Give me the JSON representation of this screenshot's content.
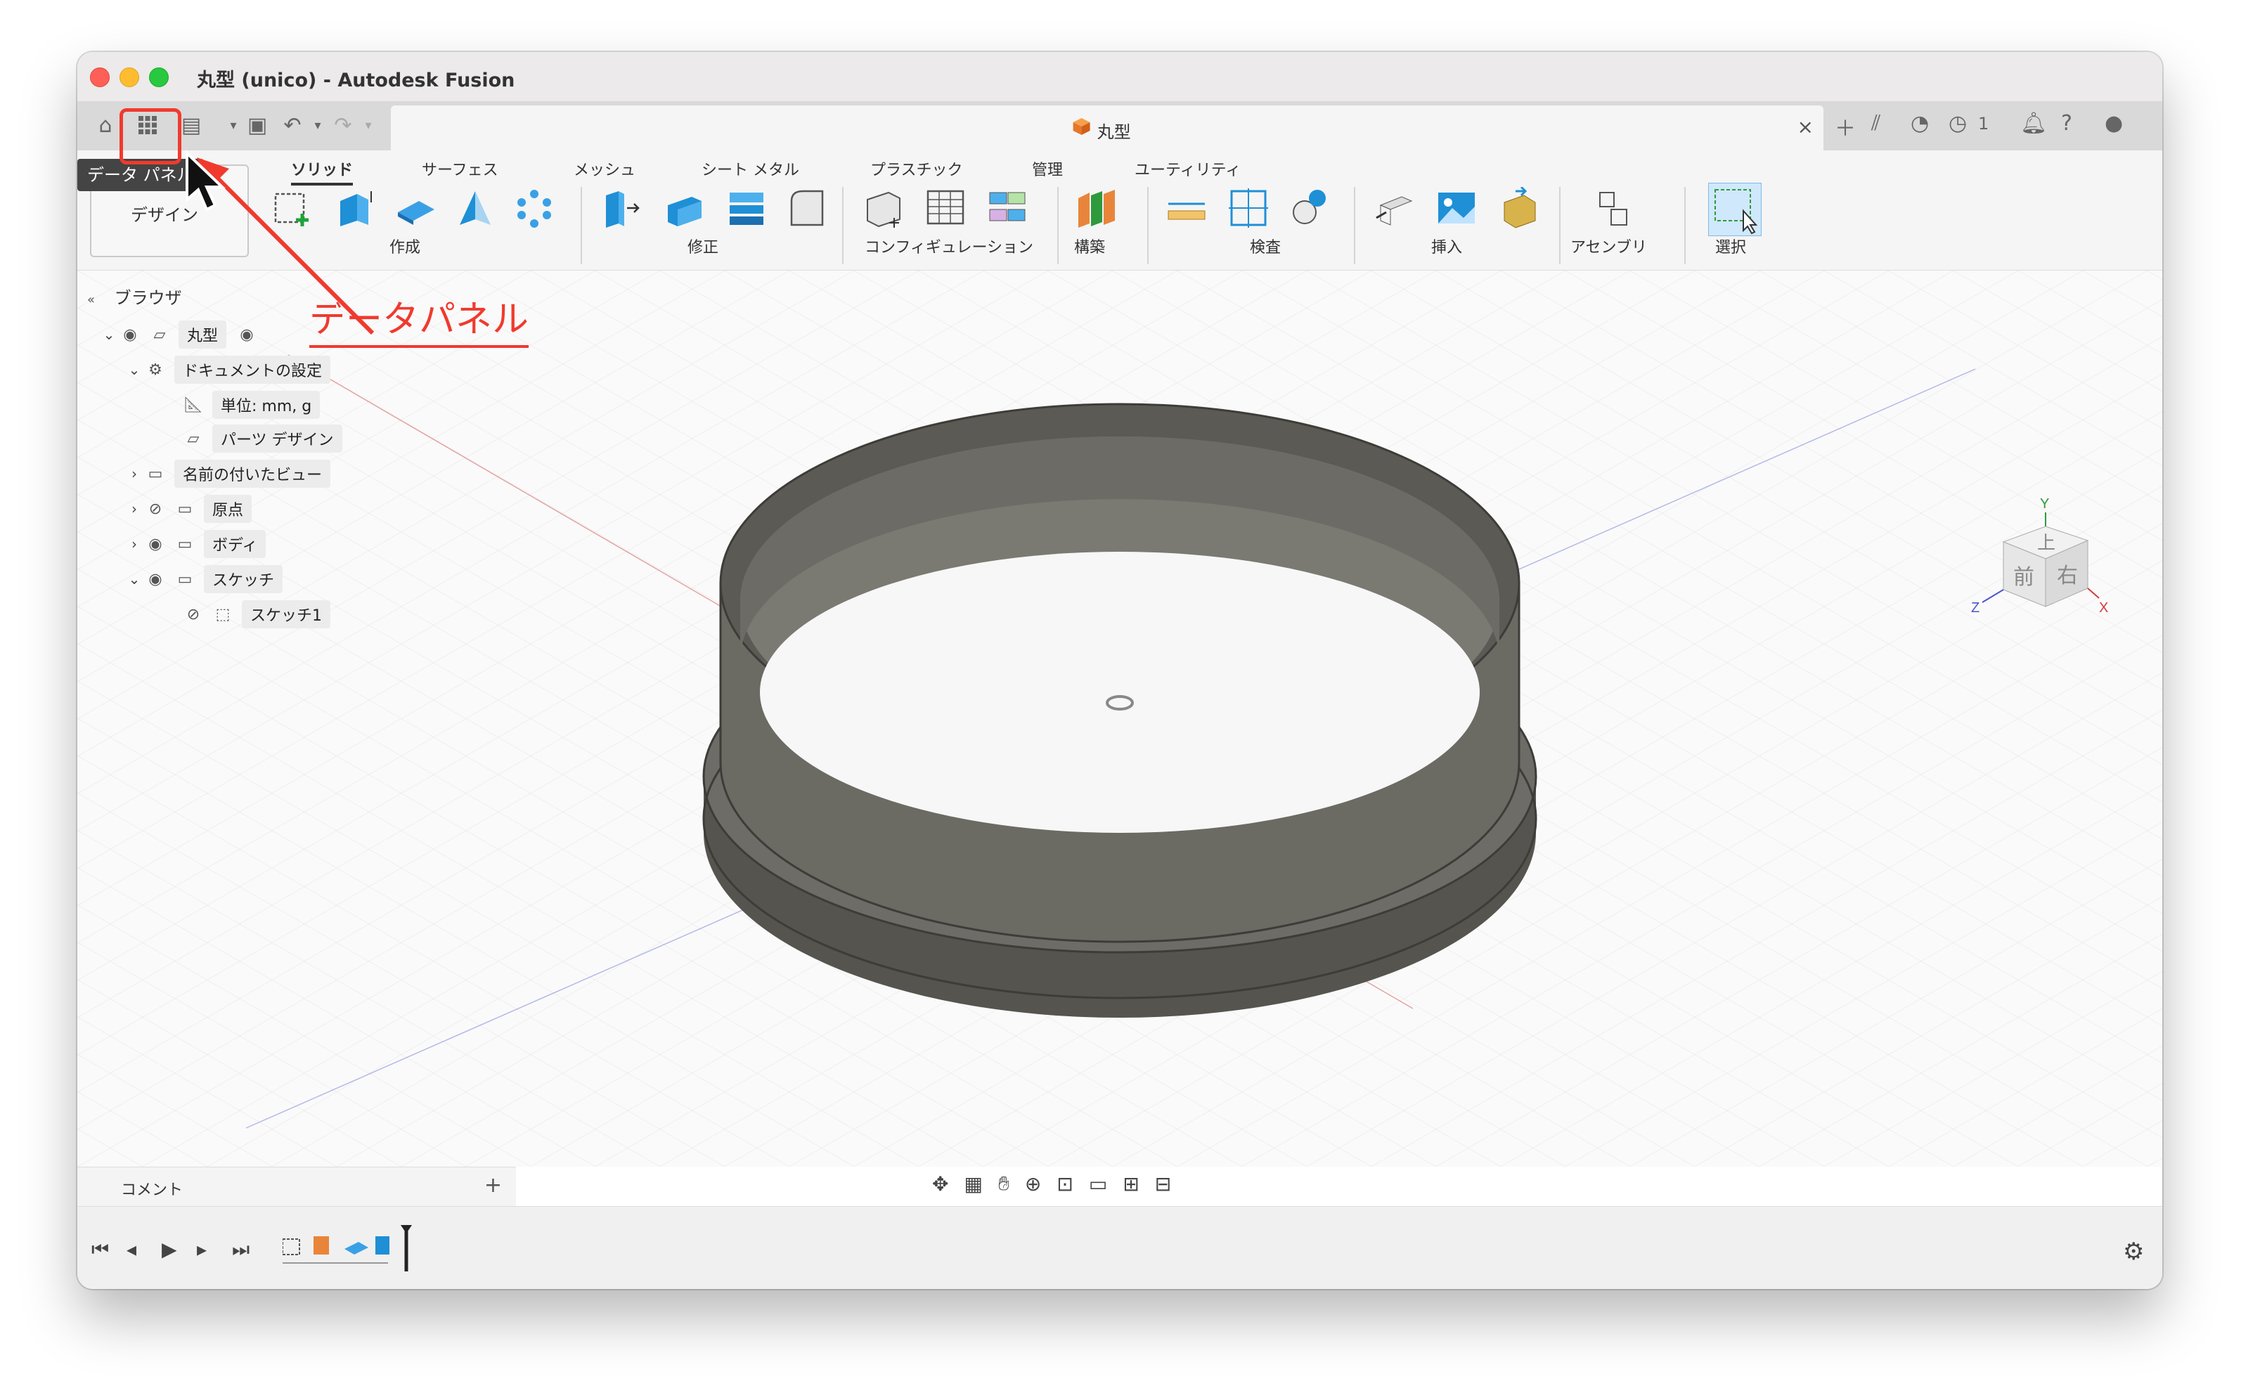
{
  "window": {
    "title": "丸型 (unico) - Autodesk Fusion"
  },
  "doc_tab": {
    "title": "丸型",
    "close_icon": "×"
  },
  "tabbar_right": {
    "notification_count": "1"
  },
  "tooltip": {
    "text": "データ パネル"
  },
  "annotation": {
    "text": "データパネル"
  },
  "workspace": {
    "label": "デザイン"
  },
  "ribbon": {
    "tabs": [
      "ソリッド",
      "サーフェス",
      "メッシュ",
      "シート メタル",
      "プラスチック",
      "管理",
      "ユーティリティ"
    ],
    "groups": [
      "作成",
      "修正",
      "コンフィギュレーション",
      "構築",
      "検査",
      "挿入",
      "アセンブリ",
      "選択"
    ]
  },
  "browser": {
    "title": "ブラウザ",
    "items": [
      {
        "label": "丸型"
      },
      {
        "label": "ドキュメントの設定"
      },
      {
        "label": "単位: mm, g"
      },
      {
        "label": "パーツ デザイン"
      },
      {
        "label": "名前の付いたビュー"
      },
      {
        "label": "原点"
      },
      {
        "label": "ボディ"
      },
      {
        "label": "スケッチ"
      },
      {
        "label": "スケッチ1"
      }
    ]
  },
  "viewcube": {
    "top": "上",
    "front": "前",
    "right": "右",
    "axis_x": "X",
    "axis_y": "Y",
    "axis_z": "Z"
  },
  "comments": {
    "label": "コメント",
    "add": "+"
  },
  "colors": {
    "annotation": "#f03a2e",
    "model": "#5f5e59",
    "accent": "#1f8fd6"
  }
}
